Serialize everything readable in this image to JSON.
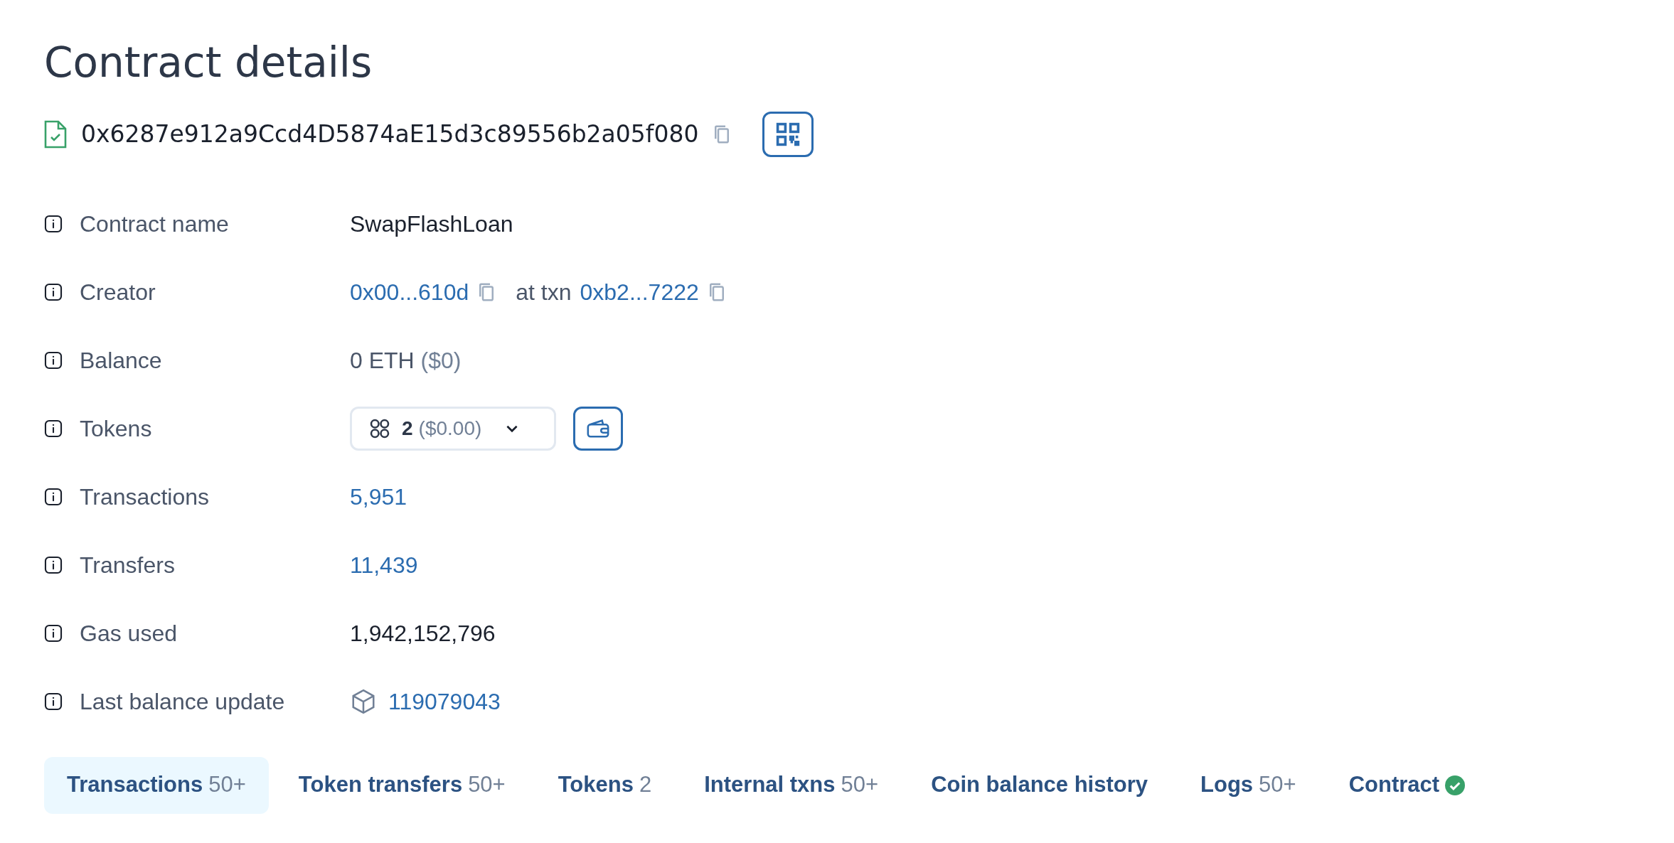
{
  "title": "Contract details",
  "address": "0x6287e912a9Ccd4D5874aE15d3c89556b2a05f080",
  "rows": [
    {
      "kind": "text",
      "label": "Contract name",
      "value": "SwapFlashLoan"
    },
    {
      "kind": "creator",
      "label": "Creator",
      "link": "0x00...610d",
      "middle": "at txn",
      "link2": "0xb2...7222"
    },
    {
      "kind": "balance",
      "label": "Balance",
      "value": "0 ETH",
      "note": "($0)"
    },
    {
      "kind": "tokens",
      "label": "Tokens",
      "count": "2",
      "note": "($0.00)"
    },
    {
      "kind": "link",
      "label": "Transactions",
      "value": "5,951"
    },
    {
      "kind": "link",
      "label": "Transfers",
      "value": "11,439"
    },
    {
      "kind": "text",
      "label": "Gas used",
      "value": "1,942,152,796"
    },
    {
      "kind": "block",
      "label": "Last balance update",
      "value": "119079043"
    }
  ],
  "tabs": [
    {
      "label": "Transactions",
      "count": "50+",
      "selected": true
    },
    {
      "label": "Token transfers",
      "count": "50+",
      "selected": false
    },
    {
      "label": "Tokens",
      "count": "2",
      "selected": false
    },
    {
      "label": "Internal txns",
      "count": "50+",
      "selected": false
    },
    {
      "label": "Coin balance history",
      "selected": false
    },
    {
      "label": "Logs",
      "count": "50+",
      "selected": false
    },
    {
      "label": "Contract",
      "verified": true,
      "selected": false
    }
  ]
}
